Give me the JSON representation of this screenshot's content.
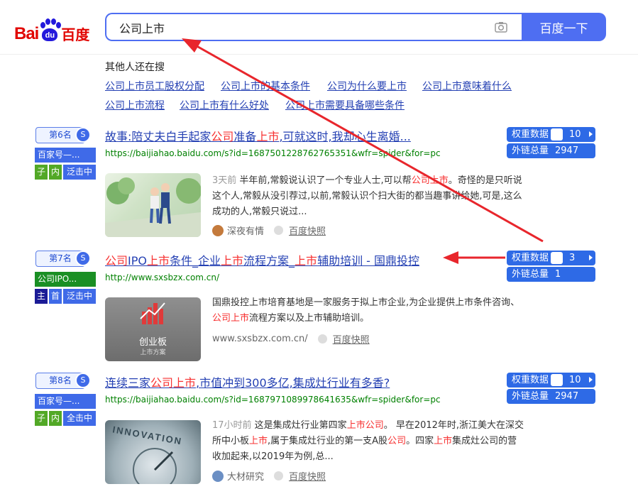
{
  "logo": {
    "bai": "Bai",
    "du": "du",
    "baidu_cn": "百度"
  },
  "search": {
    "query": "公司上市",
    "button": "百度一下"
  },
  "related": {
    "title": "其他人还在搜",
    "links": [
      "公司上市员工股权分配",
      "公司上市的基本条件",
      "公司为什么要上市",
      "公司上市意味着什么",
      "公司上市流程",
      "公司上市有什么好处",
      "公司上市需要具备哪些条件"
    ]
  },
  "results": [
    {
      "rank": "第6名",
      "rank_icon": "S",
      "source": "百家号—...",
      "chips": [
        "子",
        "内",
        "泛击中"
      ],
      "title_parts": [
        "故事:陪丈夫白手起家",
        "公司",
        "准备",
        "上市",
        ",可就这时,我却心生离婚..."
      ],
      "url": "https://baijiahao.baidu.com/s?id=1687501228762765351&wfr=spider&for=pc",
      "snippet_time": "3天前",
      "snippet_parts": [
        " 半年前,常毅说认识了一个专业人士,可以帮",
        "公司上市",
        "。奇怪的是只听说这个人,常毅从没引荐过,以前,常毅认识个扫大街的都当趣事讲给她,可是,这么成功的人,常毅只说过..."
      ],
      "meta_author": "深夜有情",
      "snapshot": "百度快照",
      "weight_label": "权重数据",
      "weight_value": "10",
      "links_label": "外链总量",
      "links_value": "2947"
    },
    {
      "rank": "第7名",
      "rank_icon": "S",
      "source": "公司IPO...",
      "chips": [
        "主",
        "首",
        "泛击中"
      ],
      "title_parts": [
        "公司",
        "IPO",
        "上市",
        "条件_企业",
        "上市",
        "流程方案_",
        "上市",
        "辅助培训 - 国鼎投控"
      ],
      "url": "http://www.sxsbzx.com.cn/",
      "snippet_parts": [
        "国鼎投控上市培育基地是一家服务于拟上市企业,为企业提供上市条件咨询、",
        "公司上市",
        "流程方案以及上市辅助培训。"
      ],
      "meta_author": "www.sxsbzx.com.cn/",
      "snapshot": "百度快照",
      "thumb_title": "创业板",
      "thumb_sub": "上市方案",
      "weight_label": "权重数据",
      "weight_value": "3",
      "links_label": "外链总量",
      "links_value": "1"
    },
    {
      "rank": "第8名",
      "rank_icon": "S",
      "source": "百家号—...",
      "chips": [
        "子",
        "内",
        "全击中"
      ],
      "title_parts": [
        "连续三家",
        "公司上市",
        ",市值冲到300多亿,集成灶行业有多香?"
      ],
      "url": "https://baijiahao.baidu.com/s?id=1687971089978641635&wfr=spider&for=pc",
      "snippet_time": "17小时前",
      "snippet_parts": [
        " 这是集成灶行业第四家",
        "上市公司",
        "。 早在2012年时,浙江美大在深交所中小板",
        "上市",
        ",属于集成灶行业的第一支A股",
        "公司",
        "。四家",
        "上市",
        "集成灶公司的营收加起来,以2019年为例,总..."
      ],
      "meta_author": "大材研究",
      "snapshot": "百度快照",
      "thumb_title": "INNOVATION",
      "weight_label": "权重数据",
      "weight_value": "10",
      "links_label": "外链总量",
      "links_value": "2947"
    }
  ],
  "colors": {
    "accent": "#4e6ef2",
    "link": "#2440b3",
    "highlight": "#f73131",
    "url": "#008000",
    "arrow": "#e8262c"
  }
}
